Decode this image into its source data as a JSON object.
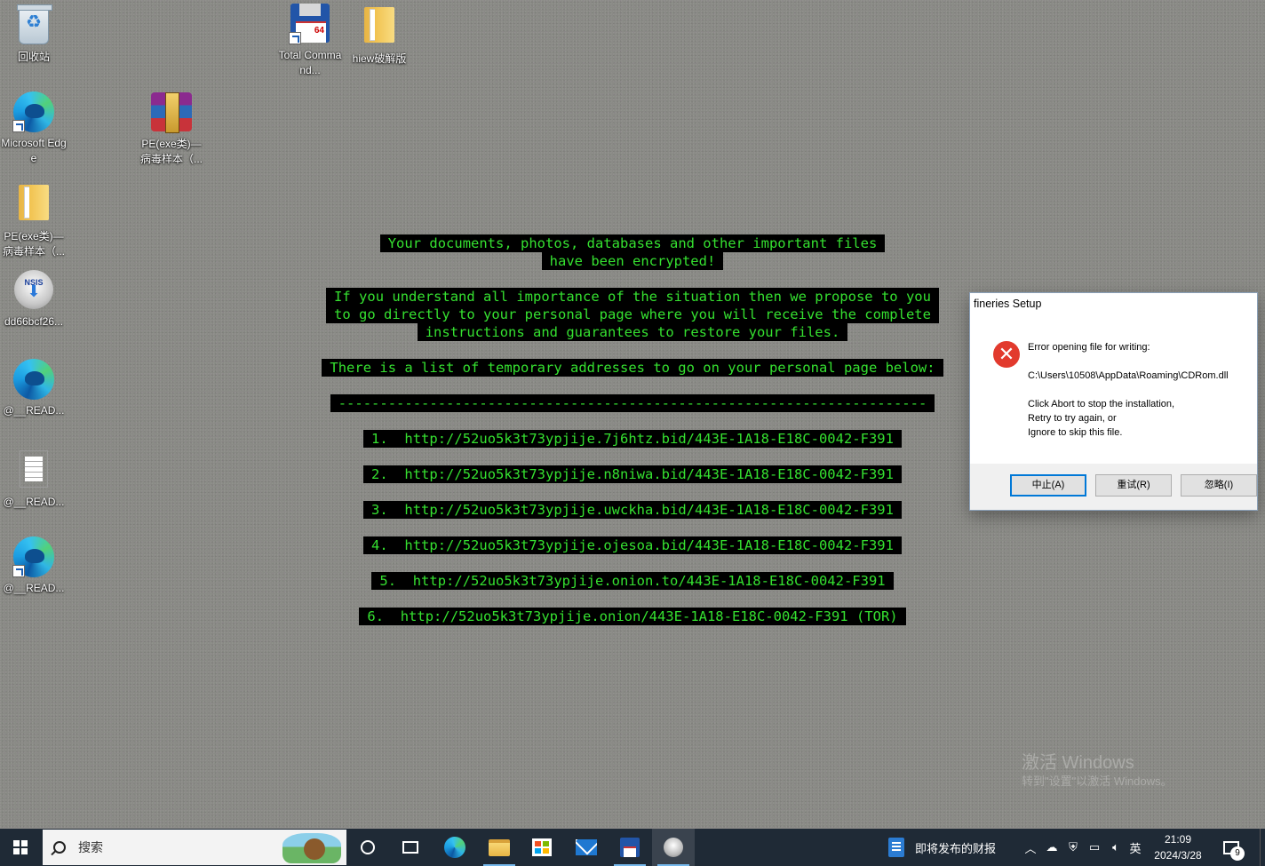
{
  "desktop": {
    "icons": [
      {
        "label": "回收站"
      },
      {
        "label": "Microsoft Edge"
      },
      {
        "label": "PE(exe类)—病毒样本（..."
      },
      {
        "label": "dd66bcf26..."
      },
      {
        "label": "@__READ..."
      },
      {
        "label": "@__READ..."
      },
      {
        "label": "@__READ..."
      },
      {
        "label": "Total Command..."
      },
      {
        "label": "hiew破解版"
      },
      {
        "label": "PE(exe类)—病毒样本（..."
      }
    ]
  },
  "ransom_note": {
    "line1": "Your documents, photos, databases and other important files",
    "line2": "have been encrypted!",
    "line3": "If you understand all importance of the situation then we propose to you",
    "line4": "to go directly to your personal page where you will receive the complete",
    "line5": "instructions and guarantees to restore your files.",
    "line6": "There is a list of temporary addresses to go on your personal page below:",
    "separator": "-----------------------------------------------------------------------",
    "links": [
      "1.  http://52uo5k3t73ypjije.7j6htz.bid/443E-1A18-E18C-0042-F391",
      "2.  http://52uo5k3t73ypjije.n8niwa.bid/443E-1A18-E18C-0042-F391",
      "3.  http://52uo5k3t73ypjije.uwckha.bid/443E-1A18-E18C-0042-F391",
      "4.  http://52uo5k3t73ypjije.ojesoa.bid/443E-1A18-E18C-0042-F391",
      "5.  http://52uo5k3t73ypjije.onion.to/443E-1A18-E18C-0042-F391",
      "6.  http://52uo5k3t73ypjije.onion/443E-1A18-E18C-0042-F391 (TOR)"
    ]
  },
  "dialog": {
    "title": "fineries Setup",
    "message": "Error opening file for writing:\n\nC:\\Users\\10508\\AppData\\Roaming\\CDRom.dll\n\nClick Abort to stop the installation,\nRetry to try again, or\nIgnore to skip this file.",
    "abort": "中止(A)",
    "retry": "重试(R)",
    "ignore": "忽略(I)"
  },
  "watermark": {
    "line1": "激活 Windows",
    "line2": "转到\"设置\"以激活 Windows。"
  },
  "taskbar": {
    "search_placeholder": "搜索",
    "news": "即将发布的财报",
    "ime": "英",
    "time": "21:09",
    "date": "2024/3/28",
    "notification_count": "9"
  },
  "colors": {
    "note_text": "#35e030",
    "note_bg": "#000000",
    "taskbar": "#1f2a36",
    "default_button_border": "#0078d7",
    "error_icon": "#e23a2d"
  }
}
